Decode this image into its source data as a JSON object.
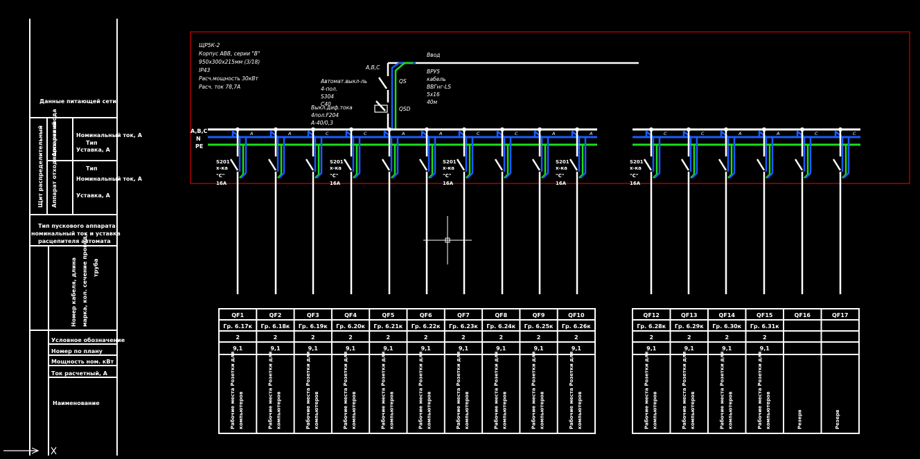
{
  "colors": {
    "background": "#000000",
    "frame": "#ff0000",
    "lines": "#ffffff",
    "neutral": "#1a5cff",
    "pe": "#19e019"
  },
  "left_table": {
    "supply_data": "Данные питающей сети",
    "panel_label": "Щит распределительный",
    "input_device": "Аппарат ввода",
    "outgoing_device": "Аппарат отходящих линий",
    "type_1": "Тип",
    "rated_current_1": "Номинальный ток, А",
    "setting_1": "Уставка, А",
    "type_2": "Тип",
    "rated_current_2": "Номинальный ток, А",
    "setting_2": "Уставка, А",
    "starter_lines": [
      "Тип пускового аппарата",
      "номинальный ток и уставка",
      "расцепителя автомата"
    ],
    "cable_rot_1": "Номер кабеля, длина",
    "cable_rot_2": "марка, кол. сечение провод.",
    "cable_rot_3": "труба",
    "symbol": "Условное обозначение",
    "plan_number": "Номер по плану",
    "power": "Мощность ном. кВт",
    "current": "Ток расчетный, А",
    "name": "Наименование"
  },
  "panel": {
    "spec_lines": [
      "ЩР5К-2",
      "Корпус ABB, серии \"B\"",
      "950х300х215мм (3/18)",
      "IP43",
      "Расч.мощность 30кВт",
      "Расч. ток 78,7А"
    ],
    "breaker_lines": [
      "Автомат.выкл-ль",
      "4-пол.",
      "S304",
      "C40"
    ],
    "rcd_lines": [
      "Выкл.диф.тока",
      "4пол.F204",
      "А-40/0,3"
    ],
    "bus_label_top": "A,B,C",
    "input_label": "Ввод",
    "cable_lines": [
      "ВРУ5",
      "кабель",
      "ВВГнг-LS",
      "5х16",
      "40м"
    ],
    "qs": "QS",
    "qsd": "QSD",
    "bus_labels": [
      "A,B,C",
      "N",
      "PE"
    ],
    "phase_letters": [
      "A",
      "A",
      "C",
      "C",
      "A",
      "A",
      "C",
      "C",
      "A",
      "A",
      "C",
      "C",
      "A",
      "A",
      "C",
      "C",
      "A",
      "A"
    ],
    "device_type": "S201",
    "device_poles": "х-ка",
    "device_char": "\"С\"",
    "device_current": "16А"
  },
  "table_rows": {
    "group1": [
      {
        "qf": "QF1",
        "line": "Гр. 6.17к",
        "n": "2",
        "p": "9,1",
        "name": "Рабочие места Розетки для компьютеров"
      },
      {
        "qf": "QF2",
        "line": "Гр. 6.18к",
        "n": "2",
        "p": "9,1",
        "name": "Рабочие места Розетки для компьютеров"
      },
      {
        "qf": "QF3",
        "line": "Гр. 6.19к",
        "n": "2",
        "p": "9,1",
        "name": "Рабочие места Розетки для компьютеров"
      },
      {
        "qf": "QF4",
        "line": "Гр. 6.20к",
        "n": "2",
        "p": "9,1",
        "name": "Рабочие места Розетки для компьютеров"
      },
      {
        "qf": "QF5",
        "line": "Гр. 6.21к",
        "n": "2",
        "p": "9,1",
        "name": "Рабочие места Розетки для компьютеров"
      },
      {
        "qf": "QF6",
        "line": "Гр. 6.22к",
        "n": "2",
        "p": "9,1",
        "name": "Рабочие места Розетки для компьютеров"
      },
      {
        "qf": "QF7",
        "line": "Гр. 6.23к",
        "n": "2",
        "p": "9,1",
        "name": "Рабочие места Розетки для компьютеров"
      },
      {
        "qf": "QF8",
        "line": "Гр. 6.24к",
        "n": "2",
        "p": "9,1",
        "name": "Рабочие места Розетки для компьютеров"
      },
      {
        "qf": "QF9",
        "line": "Гр. 6.25к",
        "n": "2",
        "p": "9,1",
        "name": "Рабочие места Розетки для компьютеров"
      },
      {
        "qf": "QF10",
        "line": "Гр. 6.26к",
        "n": "2",
        "p": "9,1",
        "name": "Рабочие места Розетки для компьютеров"
      }
    ],
    "group2": [
      {
        "qf": "QF12",
        "line": "Гр. 6.28к",
        "n": "2",
        "p": "9,1",
        "name": "Рабочие места Розетки для компьютеров"
      },
      {
        "qf": "QF13",
        "line": "Гр. 6.29к",
        "n": "2",
        "p": "9,1",
        "name": "Рабочие места Розетки для компьютеров"
      },
      {
        "qf": "QF14",
        "line": "Гр. 6.30к",
        "n": "2",
        "p": "9,1",
        "name": "Рабочие места Розетки для компьютеров"
      },
      {
        "qf": "QF15",
        "line": "Гр. 6.31к",
        "n": "2",
        "p": "9,1",
        "name": "Рабочие места Розетки для компьютеров"
      },
      {
        "qf": "QF16",
        "line": "",
        "n": "",
        "p": "",
        "name": "Резерв"
      },
      {
        "qf": "QF17",
        "line": "",
        "n": "",
        "p": "",
        "name": "Резерв"
      }
    ]
  }
}
